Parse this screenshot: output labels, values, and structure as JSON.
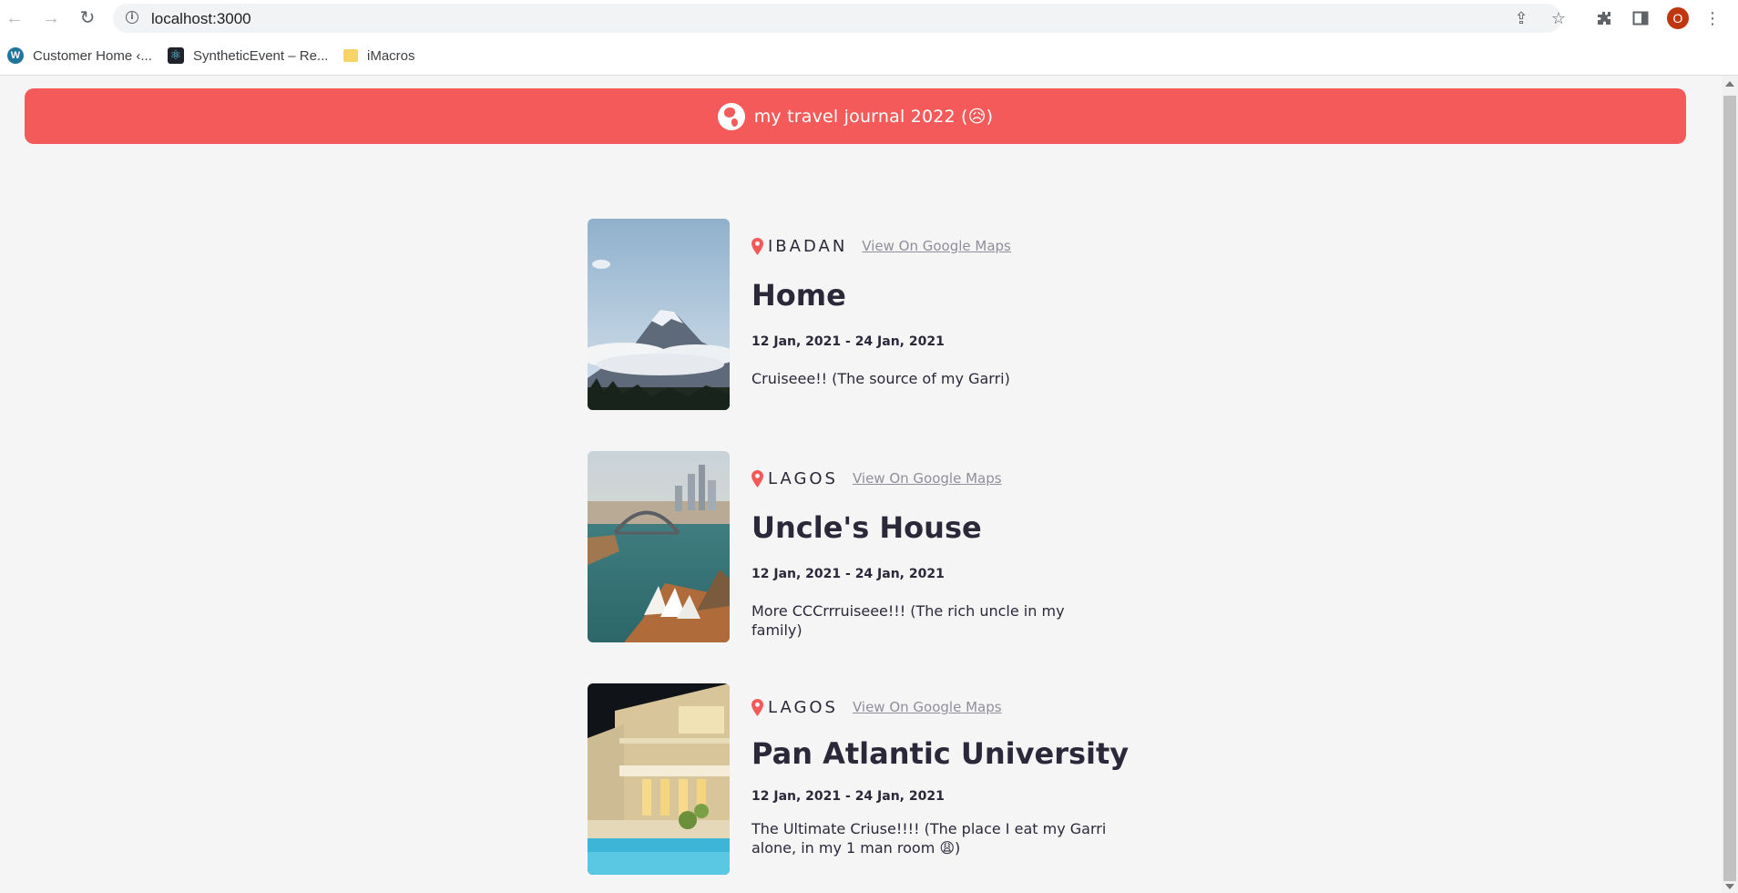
{
  "browser": {
    "url": "localhost:3000",
    "avatar_initial": "O",
    "bookmarks": [
      {
        "label": "Customer Home ‹...",
        "icon": "wordpress-icon"
      },
      {
        "label": "SyntheticEvent – Re...",
        "icon": "react-icon"
      },
      {
        "label": "iMacros",
        "icon": "folder-icon"
      }
    ]
  },
  "header": {
    "title": "my travel journal 2022 (😥)",
    "icon": "globe-icon",
    "color": "#f55a5a"
  },
  "entries": [
    {
      "location": "IBADAN",
      "maps_link": "View On Google Maps",
      "title": "Home",
      "dates": "12 Jan, 2021 - 24 Jan, 2021",
      "description": "Cruiseee!! (The source of my Garri)"
    },
    {
      "location": "LAGOS",
      "maps_link": "View On Google Maps",
      "title": "Uncle's House",
      "dates": "12 Jan, 2021 - 24 Jan, 2021",
      "description": "More CCCrrruiseee!!! (The rich uncle in my family)"
    },
    {
      "location": "LAGOS",
      "maps_link": "View On Google Maps",
      "title": "Pan Atlantic University",
      "dates": "12 Jan, 2021 - 24 Jan, 2021",
      "description": "The Ultimate Criuse!!!! (The place I eat my Garri alone, in my 1 man room 😩)"
    }
  ]
}
